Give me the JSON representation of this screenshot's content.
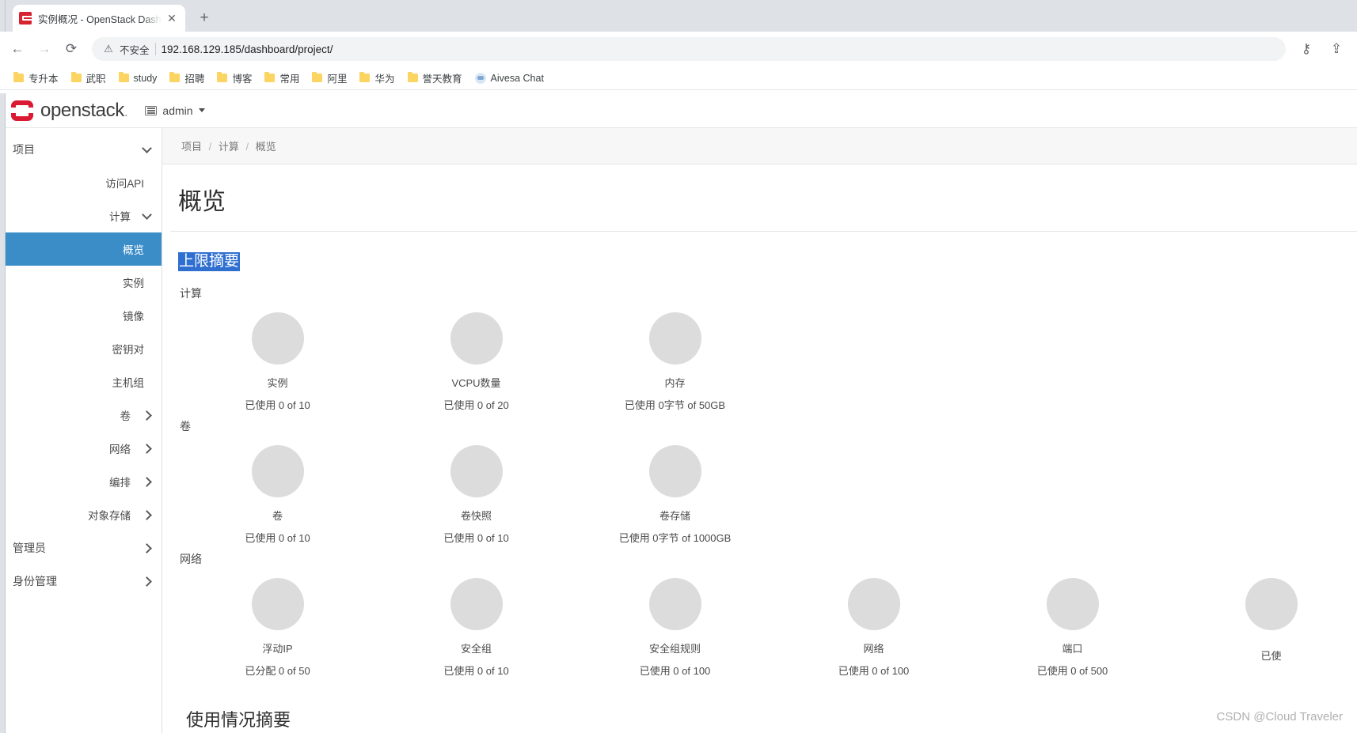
{
  "browser": {
    "tab": {
      "title": "实例概况 - OpenStack Dashboa",
      "close": "✕"
    },
    "new_tab": "+",
    "nav": {
      "back": "←",
      "forward": "→",
      "reload": "⟳"
    },
    "omnibox": {
      "warning_icon": "⚠",
      "security_label": "不安全",
      "url": "192.168.129.185/dashboard/project/"
    },
    "toolbar_right": {
      "key_icon": "⚷",
      "share_icon": "⇪"
    },
    "bookmarks": [
      {
        "label": "专升本",
        "icon": "folder-icon"
      },
      {
        "label": "武职",
        "icon": "folder-icon"
      },
      {
        "label": "study",
        "icon": "folder-icon"
      },
      {
        "label": "招聘",
        "icon": "folder-icon"
      },
      {
        "label": "博客",
        "icon": "folder-icon"
      },
      {
        "label": "常用",
        "icon": "folder-icon"
      },
      {
        "label": "阿里",
        "icon": "folder-icon"
      },
      {
        "label": "华为",
        "icon": "folder-icon"
      },
      {
        "label": "誉天教育",
        "icon": "folder-icon"
      },
      {
        "label": "Aivesa Chat",
        "icon": "chat-icon"
      }
    ]
  },
  "header": {
    "brand": "openstack",
    "brand_dot": ".",
    "project": "admin"
  },
  "sidebar": {
    "groups": [
      {
        "label": "项目",
        "type": "group",
        "chevron": "down"
      },
      {
        "label": "访问API",
        "type": "item"
      },
      {
        "label": "计算",
        "type": "subgroup",
        "chevron": "down"
      },
      {
        "label": "概览",
        "type": "item",
        "active": true
      },
      {
        "label": "实例",
        "type": "item"
      },
      {
        "label": "镜像",
        "type": "item"
      },
      {
        "label": "密钥对",
        "type": "item"
      },
      {
        "label": "主机组",
        "type": "item"
      },
      {
        "label": "卷",
        "type": "subgroup",
        "chevron": "right"
      },
      {
        "label": "网络",
        "type": "subgroup",
        "chevron": "right"
      },
      {
        "label": "编排",
        "type": "subgroup",
        "chevron": "right"
      },
      {
        "label": "对象存储",
        "type": "subgroup",
        "chevron": "right"
      },
      {
        "label": "管理员",
        "type": "group",
        "chevron": "right"
      },
      {
        "label": "身份管理",
        "type": "group",
        "chevron": "right"
      }
    ]
  },
  "main": {
    "breadcrumb": [
      "项目",
      "计算",
      "概览"
    ],
    "breadcrumb_sep": "/",
    "title": "概览",
    "limit_summary_title": "上限摘要",
    "usage_summary_title": "使用情况摘要",
    "sections": [
      {
        "label": "计算",
        "gauges": [
          {
            "label": "实例",
            "value": "已使用 0 of 10"
          },
          {
            "label": "VCPU数量",
            "value": "已使用 0 of 20"
          },
          {
            "label": "内存",
            "value": "已使用 0字节 of 50GB"
          }
        ]
      },
      {
        "label": "卷",
        "gauges": [
          {
            "label": "卷",
            "value": "已使用 0 of 10"
          },
          {
            "label": "卷快照",
            "value": "已使用 0 of 10"
          },
          {
            "label": "卷存储",
            "value": "已使用 0字节 of 1000GB"
          }
        ]
      },
      {
        "label": "网络",
        "gauges": [
          {
            "label": "浮动IP",
            "value": "已分配 0 of 50"
          },
          {
            "label": "安全组",
            "value": "已使用 0 of 10"
          },
          {
            "label": "安全组规则",
            "value": "已使用 0 of 100"
          },
          {
            "label": "网络",
            "value": "已使用 0 of 100"
          },
          {
            "label": "端口",
            "value": "已使用 0 of 500"
          },
          {
            "label": "",
            "value": "已使"
          }
        ]
      }
    ]
  },
  "watermark": "CSDN @Cloud Traveler",
  "colors": {
    "accent_blue": "#3b8dc8",
    "selection_blue": "#2f6fd0",
    "brand_red": "#da1a32",
    "gauge_gray": "#dcdcdc"
  }
}
